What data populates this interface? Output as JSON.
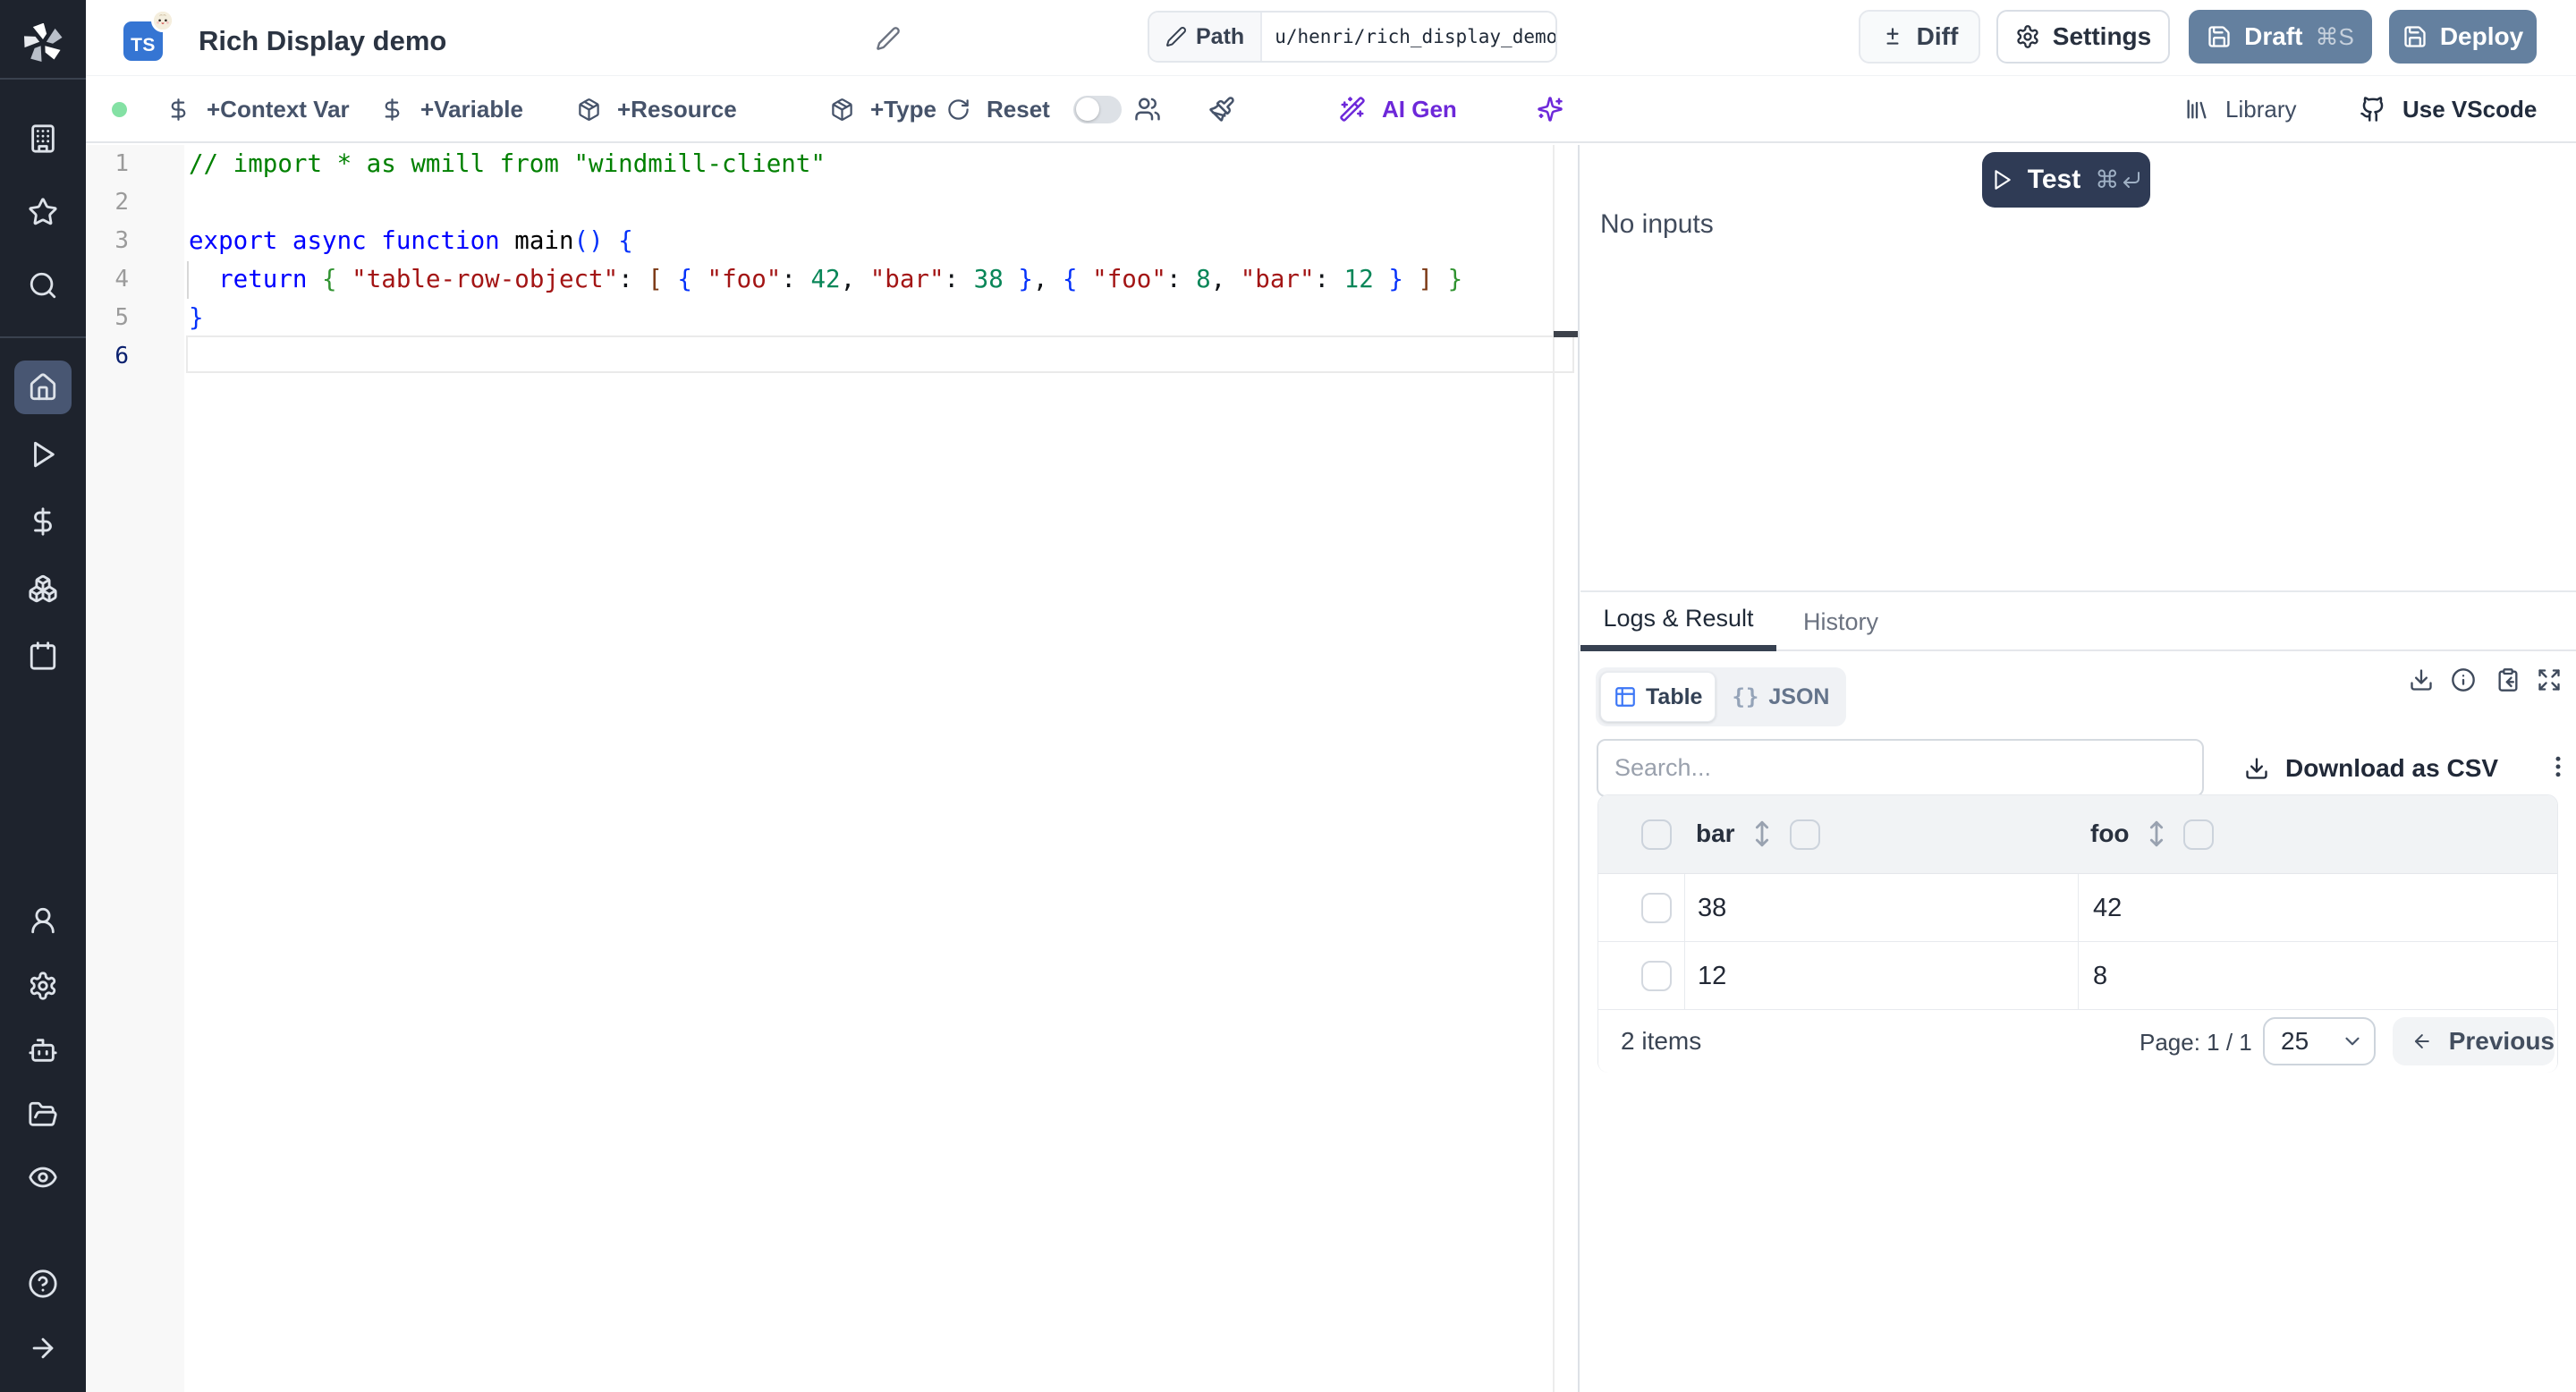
{
  "colors": {
    "sidebar_bg": "#1e232d",
    "sidebar_active_bg": "#434f68",
    "accent_purple": "#6d28d9",
    "steel_button": "#64809f",
    "test_button": "#2f3b55",
    "status_dot": "#84e1a4",
    "ts_badge": "#3575d3",
    "table_icon_blue": "#3b76f6"
  },
  "sidebar": {
    "items_top": [
      "windmill-logo",
      "workspace",
      "favorites",
      "search"
    ],
    "items_mid": [
      "home",
      "runs",
      "variables",
      "resources",
      "schedules"
    ],
    "items_bottom": [
      "workers",
      "settings",
      "ai",
      "folders",
      "audit-logs"
    ],
    "items_foot": [
      "help",
      "collapse"
    ],
    "active_item": "home"
  },
  "header": {
    "language_badge": "TS",
    "title": "Rich Display demo",
    "path_label": "Path",
    "path_value": "u/henri/rich_display_demo",
    "diff_label": "Diff",
    "settings_label": "Settings",
    "draft_label": "Draft",
    "draft_shortcut": "⌘S",
    "deploy_label": "Deploy"
  },
  "toolbar": {
    "context_var_label": "+Context Var",
    "variable_label": "+Variable",
    "resource_label": "+Resource",
    "type_label": "+Type",
    "reset_label": "Reset",
    "ai_gen_label": "AI Gen",
    "library_label": "Library",
    "vscode_label": "Use VScode"
  },
  "editor": {
    "line_numbers": [
      "1",
      "2",
      "3",
      "4",
      "5",
      "6"
    ],
    "active_line": 6,
    "lines": [
      [
        [
          "cmt",
          "// import * as wmill from \"windmill-client\""
        ]
      ],
      [],
      [
        [
          "kw",
          "export"
        ],
        [
          "",
          " "
        ],
        [
          "kw",
          "async"
        ],
        [
          "",
          " "
        ],
        [
          "kw",
          "function"
        ],
        [
          "",
          " "
        ],
        [
          "id",
          "main"
        ],
        [
          "b1",
          "()"
        ],
        [
          "",
          " "
        ],
        [
          "b1",
          "{"
        ]
      ],
      [
        [
          "",
          "  "
        ],
        [
          "kw",
          "return"
        ],
        [
          "",
          " "
        ],
        [
          "b2",
          "{"
        ],
        [
          "",
          " "
        ],
        [
          "str",
          "\"table-row-object\""
        ],
        [
          "",
          ": "
        ],
        [
          "b3",
          "["
        ],
        [
          "",
          " "
        ],
        [
          "b1",
          "{"
        ],
        [
          "",
          " "
        ],
        [
          "str",
          "\"foo\""
        ],
        [
          "",
          ": "
        ],
        [
          "num",
          "42"
        ],
        [
          "",
          ", "
        ],
        [
          "str",
          "\"bar\""
        ],
        [
          "",
          ": "
        ],
        [
          "num",
          "38"
        ],
        [
          "",
          " "
        ],
        [
          "b1",
          "}"
        ],
        [
          "",
          ", "
        ],
        [
          "b1",
          "{"
        ],
        [
          "",
          " "
        ],
        [
          "str",
          "\"foo\""
        ],
        [
          "",
          ": "
        ],
        [
          "num",
          "8"
        ],
        [
          "",
          ", "
        ],
        [
          "str",
          "\"bar\""
        ],
        [
          "",
          ": "
        ],
        [
          "num",
          "12"
        ],
        [
          "",
          " "
        ],
        [
          "b1",
          "}"
        ],
        [
          "",
          " "
        ],
        [
          "b3",
          "]"
        ],
        [
          "",
          " "
        ],
        [
          "b2",
          "}"
        ]
      ],
      [
        [
          "b1",
          "}"
        ]
      ],
      []
    ]
  },
  "preview": {
    "test_label": "Test",
    "test_shortcut_cmd": "⌘",
    "no_inputs_label": "No inputs",
    "tab_logs_label": "Logs & Result",
    "tab_history_label": "History",
    "seg_table_label": "Table",
    "seg_json_label": "JSON",
    "seg_json_braces": "{}",
    "search_placeholder": "Search...",
    "download_csv_label": "Download as CSV",
    "table": {
      "columns": [
        "bar",
        "foo"
      ],
      "rows": [
        [
          "38",
          "42"
        ],
        [
          "12",
          "8"
        ]
      ]
    },
    "footer": {
      "items_label": "2 items",
      "page_label": "Page: 1 / 1",
      "page_size_value": "25",
      "previous_label": "Previous"
    }
  }
}
